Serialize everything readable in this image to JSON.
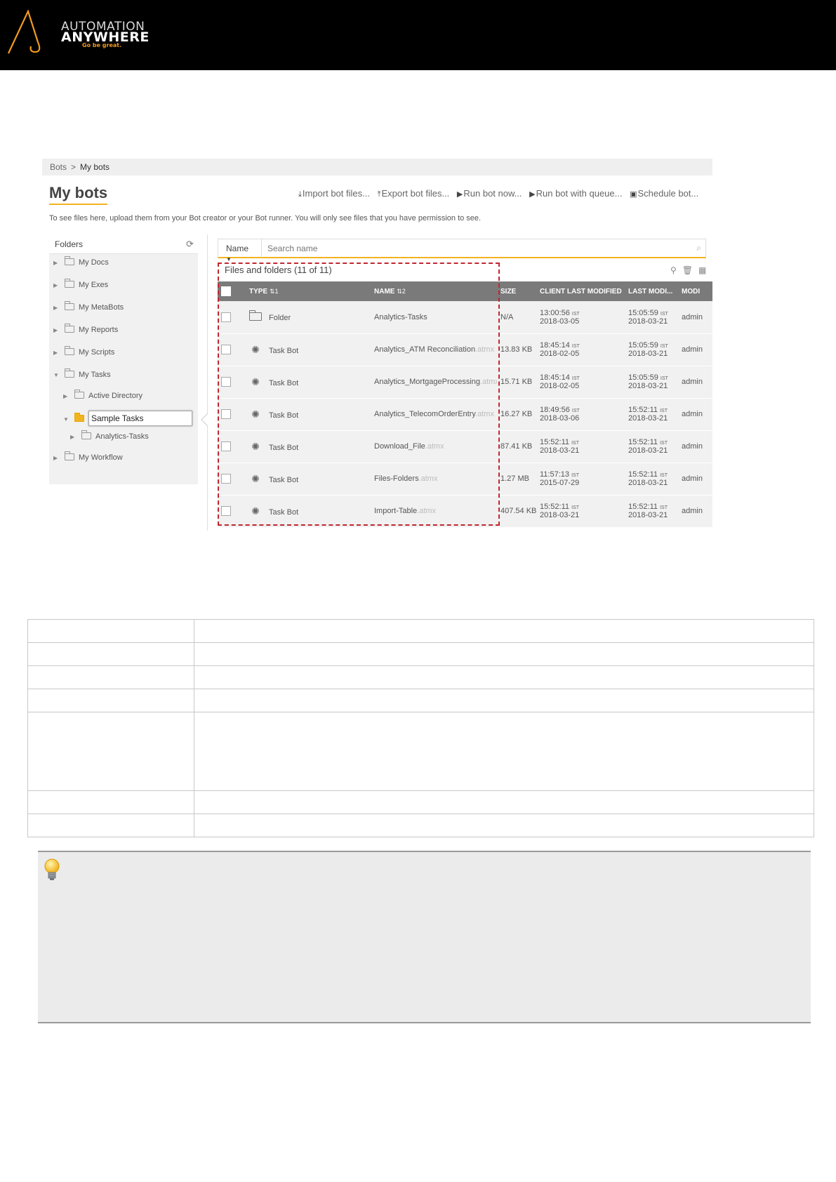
{
  "brand": {
    "line1": "AUTOMATION",
    "line2": "ANYWHERE",
    "tagline": "Go be great.",
    "accent_color": "#f29a1f"
  },
  "breadcrumb": {
    "root": "Bots",
    "separator": ">",
    "current": "My bots"
  },
  "page": {
    "title": "My bots",
    "help": "To see files here, upload them from your Bot creator or your Bot runner. You will only see files that you have permission to see."
  },
  "toolbar": {
    "import": "Import bot files...",
    "export": "Export bot files...",
    "run_now": "Run bot now...",
    "run_queue": "Run bot with queue...",
    "schedule": "Schedule bot..."
  },
  "folders": {
    "title": "Folders",
    "items": [
      {
        "label": "My Docs"
      },
      {
        "label": "My Exes"
      },
      {
        "label": "My MetaBots"
      },
      {
        "label": "My Reports"
      },
      {
        "label": "My Scripts"
      },
      {
        "label": "My Tasks"
      },
      {
        "label": "Active Directory"
      },
      {
        "label": "Sample Tasks"
      },
      {
        "label": "Analytics-Tasks"
      },
      {
        "label": "My Workflow"
      }
    ]
  },
  "search": {
    "field": "Name",
    "placeholder": "Search name"
  },
  "list": {
    "title": "Files and folders",
    "count": "(11 of 11)",
    "columns": [
      "TYPE",
      "NAME",
      "SIZE",
      "CLIENT LAST MODIFIED",
      "LAST MODI...",
      "MODI"
    ],
    "sort_marks": {
      "type": "1",
      "name": "2"
    },
    "rows": [
      {
        "type": "Folder",
        "name": "Analytics-Tasks",
        "ext": "",
        "size": "N/A",
        "client_time": "13:00:56",
        "client_date": "2018-03-05",
        "mod_time": "15:05:59",
        "mod_date": "2018-03-21",
        "by": "admin"
      },
      {
        "type": "Task Bot",
        "name": "Analytics_ATM Reconciliation",
        "ext": ".atmx",
        "size": "13.83 KB",
        "client_time": "18:45:14",
        "client_date": "2018-02-05",
        "mod_time": "15:05:59",
        "mod_date": "2018-03-21",
        "by": "admin"
      },
      {
        "type": "Task Bot",
        "name": "Analytics_MortgageProcessing",
        "ext": ".atmx",
        "size": "15.71 KB",
        "client_time": "18:45:14",
        "client_date": "2018-02-05",
        "mod_time": "15:05:59",
        "mod_date": "2018-03-21",
        "by": "admin"
      },
      {
        "type": "Task Bot",
        "name": "Analytics_TelecomOrderEntry",
        "ext": ".atmx",
        "size": "16.27 KB",
        "client_time": "18:49:56",
        "client_date": "2018-03-06",
        "mod_time": "15:52:11",
        "mod_date": "2018-03-21",
        "by": "admin"
      },
      {
        "type": "Task Bot",
        "name": "Download_File",
        "ext": ".atmx",
        "size": "87.41 KB",
        "client_time": "15:52:11",
        "client_date": "2018-03-21",
        "mod_time": "15:52:11",
        "mod_date": "2018-03-21",
        "by": "admin"
      },
      {
        "type": "Task Bot",
        "name": "Files-Folders",
        "ext": ".atmx",
        "size": "1.27 MB",
        "client_time": "11:57:13",
        "client_date": "2015-07-29",
        "mod_time": "15:52:11",
        "mod_date": "2018-03-21",
        "by": "admin"
      },
      {
        "type": "Task Bot",
        "name": "Import-Table",
        "ext": ".atmx",
        "size": "407.54 KB",
        "client_time": "15:52:11",
        "client_date": "2018-03-21",
        "mod_time": "15:52:11",
        "mod_date": "2018-03-21",
        "by": "admin"
      }
    ],
    "timezone": "IST"
  },
  "colors": {
    "accent": "#f2b320",
    "header_row": "#7a7a7a",
    "highlight_dash": "#c0272d"
  }
}
